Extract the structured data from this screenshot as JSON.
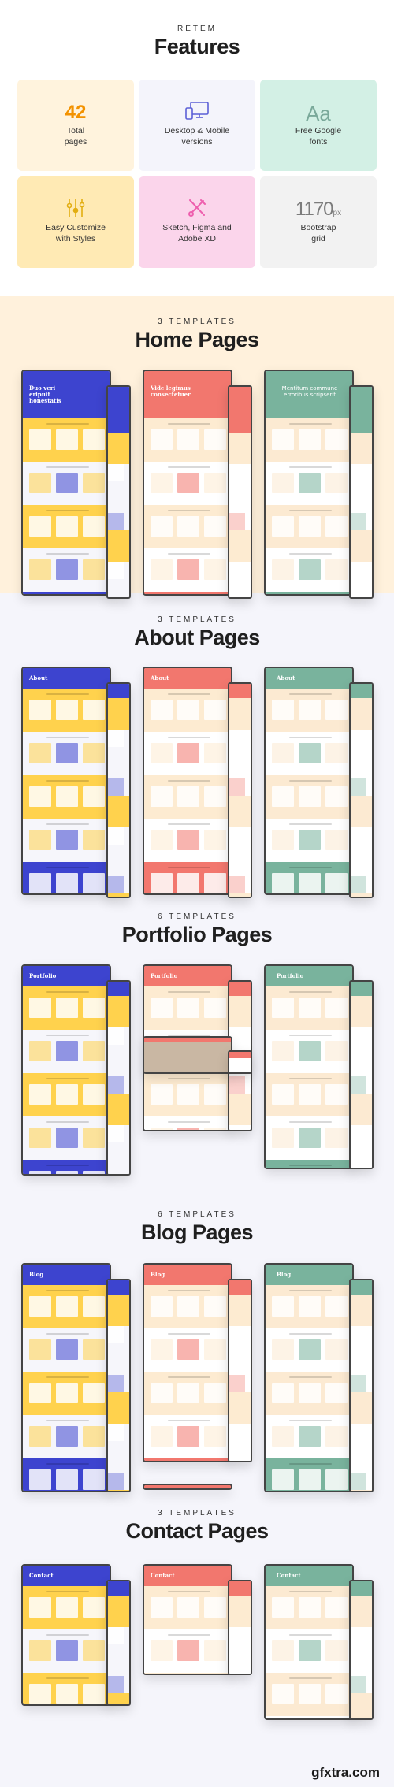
{
  "header": {
    "eyebrow": "RETEM",
    "title": "Features"
  },
  "features": [
    {
      "id": "total-pages",
      "value": "42",
      "label_line1": "Total",
      "label_line2": "pages",
      "bg": "#fff3dd",
      "accent": "#f39200"
    },
    {
      "id": "desktop-mobile",
      "icon": "devices-icon",
      "label_line1": "Desktop & Mobile",
      "label_line2": "versions",
      "bg": "#f4f4fb",
      "accent": "#5b5fd6"
    },
    {
      "id": "google-fonts",
      "value": "Aa",
      "label_line1": "Free Google",
      "label_line2": "fonts",
      "bg": "#d3f0e5",
      "accent": "#7aa99a"
    },
    {
      "id": "customize",
      "icon": "sliders-icon",
      "label_line1": "Easy Customize",
      "label_line2": "with Styles",
      "bg": "#ffeab4",
      "accent": "#e2ad10"
    },
    {
      "id": "design-tools",
      "icon": "tools-icon",
      "label_line1": "Sketch, Figma and",
      "label_line2": "Adobe XD",
      "bg": "#fbd5eb",
      "accent": "#ee5fae"
    },
    {
      "id": "grid",
      "value": "1170",
      "unit": "px",
      "label_line1": "Bootstrap",
      "label_line2": "grid",
      "bg": "#f2f2f2",
      "accent": "#7c7c7c"
    }
  ],
  "sections": [
    {
      "id": "home",
      "eyebrow": "3 TEMPLATES",
      "title": "Home Pages",
      "mockups": [
        {
          "theme": "blue",
          "hero_text": "Duo veri eripuit honestatis"
        },
        {
          "theme": "coral",
          "hero_text": "Vide legimus consectetuer"
        },
        {
          "theme": "green",
          "hero_text": "Mentitum commune erroribus scripserit"
        }
      ]
    },
    {
      "id": "about",
      "eyebrow": "3 TEMPLATES",
      "title": "About Pages",
      "mockups": [
        {
          "theme": "blue",
          "hero_text": "About"
        },
        {
          "theme": "coral",
          "hero_text": "About"
        },
        {
          "theme": "green",
          "hero_text": "About"
        }
      ]
    },
    {
      "id": "portfolio",
      "eyebrow": "6 TEMPLATES",
      "title": "Portfolio Pages",
      "mockups": [
        {
          "theme": "blue",
          "hero_text": "Portfolio"
        },
        {
          "theme": "coral",
          "hero_text": "Portfolio"
        },
        {
          "theme": "green",
          "hero_text": "Portfolio"
        }
      ]
    },
    {
      "id": "blog",
      "eyebrow": "6 TEMPLATES",
      "title": "Blog Pages",
      "mockups": [
        {
          "theme": "blue",
          "hero_text": "Blog"
        },
        {
          "theme": "coral",
          "hero_text": "Blog"
        },
        {
          "theme": "green",
          "hero_text": "Blog"
        }
      ]
    },
    {
      "id": "contact",
      "eyebrow": "3 TEMPLATES",
      "title": "Contact Pages",
      "mockups": [
        {
          "theme": "blue",
          "hero_text": "Contact"
        },
        {
          "theme": "coral",
          "hero_text": "Contact"
        },
        {
          "theme": "green",
          "hero_text": "Contact"
        }
      ]
    }
  ],
  "themes": {
    "blue": {
      "primary": "#3d44cf",
      "secondary": "#ffd24d",
      "surface": "#f6f6fb"
    },
    "coral": {
      "primary": "#f2776e",
      "secondary": "#fdebd1",
      "surface": "#ffffff"
    },
    "green": {
      "primary": "#79b39d",
      "secondary": "#fcead2",
      "surface": "#ffffff"
    }
  },
  "colors": {
    "page_bg": "#f5f5fb",
    "home_bg": "#fff1dc",
    "text_dark": "#1f1f1f"
  },
  "watermark": "gfxtra.com"
}
